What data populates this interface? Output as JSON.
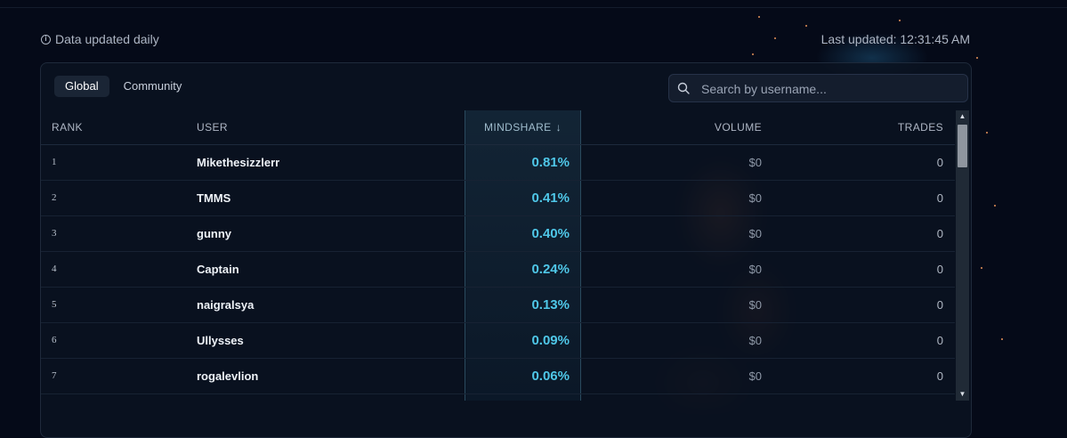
{
  "notice": {
    "text": "Data updated daily"
  },
  "last_updated": "Last updated: 12:31:45 AM",
  "tabs": [
    {
      "label": "Global",
      "active": true
    },
    {
      "label": "Community",
      "active": false
    }
  ],
  "search": {
    "placeholder": "Search by username..."
  },
  "table": {
    "columns": {
      "rank": "RANK",
      "user": "USER",
      "mindshare": "MINDSHARE",
      "volume": "VOLUME",
      "trades": "TRADES"
    },
    "sort": {
      "column": "MINDSHARE",
      "direction": "descending"
    },
    "rows": [
      {
        "rank": "1",
        "user": "Mikethesizzlerr",
        "mindshare": "0.81%",
        "volume": "$0",
        "trades": "0"
      },
      {
        "rank": "2",
        "user": "TMMS",
        "mindshare": "0.41%",
        "volume": "$0",
        "trades": "0"
      },
      {
        "rank": "3",
        "user": "gunny",
        "mindshare": "0.40%",
        "volume": "$0",
        "trades": "0"
      },
      {
        "rank": "4",
        "user": "Captain",
        "mindshare": "0.24%",
        "volume": "$0",
        "trades": "0"
      },
      {
        "rank": "5",
        "user": "naigralsya",
        "mindshare": "0.13%",
        "volume": "$0",
        "trades": "0"
      },
      {
        "rank": "6",
        "user": "Ullysses",
        "mindshare": "0.09%",
        "volume": "$0",
        "trades": "0"
      },
      {
        "rank": "7",
        "user": "rogalevlion",
        "mindshare": "0.06%",
        "volume": "$0",
        "trades": "0"
      }
    ]
  },
  "colors": {
    "background": "#050a18",
    "accent_mindshare": "#4fc7e8",
    "card": "#0b1321"
  },
  "icons": {
    "notice": "info-icon",
    "search": "search-icon",
    "sort": "arrow-down-icon"
  }
}
